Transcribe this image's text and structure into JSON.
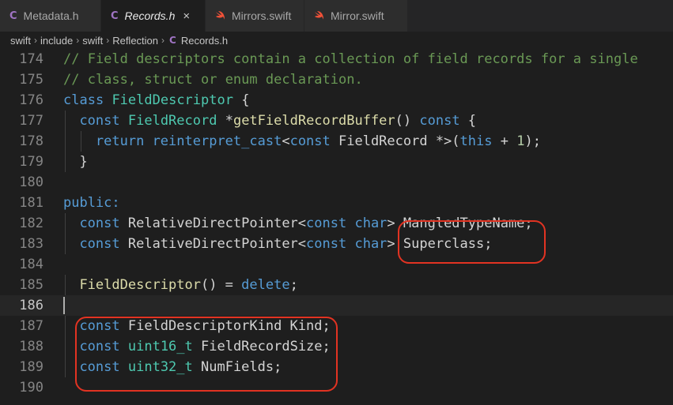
{
  "tabs": [
    {
      "name": "Metadata.h",
      "kind": "c",
      "active": false
    },
    {
      "name": "Records.h",
      "kind": "c",
      "active": true
    },
    {
      "name": "Mirrors.swift",
      "kind": "swift",
      "active": false
    },
    {
      "name": "Mirror.swift",
      "kind": "swift",
      "active": false
    }
  ],
  "tab_icons": {
    "c": "C",
    "close": "×"
  },
  "breadcrumb": [
    "swift",
    "include",
    "swift",
    "Reflection",
    "Records.h"
  ],
  "breadcrumb_sep": "›",
  "colors": {
    "comment": "#6a9955",
    "keyword": "#569cd6",
    "type": "#4ec9b0",
    "function": "#dcdcaa",
    "number": "#b5cea8",
    "text": "#d4d4d4",
    "highlight": "#e23322",
    "c_icon": "#a074c4",
    "swift_icon": "#f05138"
  },
  "current_line": 186,
  "lines": [
    {
      "n": 174,
      "indent": 0,
      "tokens": [
        [
          "cm",
          "// Field descriptors contain a collection of field records for a single"
        ]
      ]
    },
    {
      "n": 175,
      "indent": 0,
      "tokens": [
        [
          "cm",
          "// class, struct or enum declaration."
        ]
      ]
    },
    {
      "n": 176,
      "indent": 0,
      "tokens": [
        [
          "kw",
          "class"
        ],
        [
          "p",
          " "
        ],
        [
          "ty",
          "FieldDescriptor"
        ],
        [
          "p",
          " {"
        ]
      ]
    },
    {
      "n": 177,
      "indent": 1,
      "tokens": [
        [
          "kw",
          "const"
        ],
        [
          "p",
          " "
        ],
        [
          "ty",
          "FieldRecord"
        ],
        [
          "p",
          " *"
        ],
        [
          "fn",
          "getFieldRecordBuffer"
        ],
        [
          "p",
          "() "
        ],
        [
          "kw",
          "const"
        ],
        [
          "p",
          " {"
        ]
      ]
    },
    {
      "n": 178,
      "indent": 2,
      "tokens": [
        [
          "kw",
          "return"
        ],
        [
          "p",
          " "
        ],
        [
          "kw",
          "reinterpret_cast"
        ],
        [
          "p",
          "<"
        ],
        [
          "kw",
          "const"
        ],
        [
          "p",
          " FieldRecord *>("
        ],
        [
          "kw",
          "this"
        ],
        [
          "p",
          " + "
        ],
        [
          "num",
          "1"
        ],
        [
          "p",
          ");"
        ]
      ]
    },
    {
      "n": 179,
      "indent": 1,
      "tokens": [
        [
          "p",
          "}"
        ]
      ]
    },
    {
      "n": 180,
      "indent": 0,
      "tokens": []
    },
    {
      "n": 181,
      "indent": 0,
      "tokens": [
        [
          "kw",
          "public:"
        ]
      ]
    },
    {
      "n": 182,
      "indent": 1,
      "tokens": [
        [
          "kw",
          "const"
        ],
        [
          "p",
          " RelativeDirectPointer<"
        ],
        [
          "kw",
          "const"
        ],
        [
          "p",
          " "
        ],
        [
          "kw",
          "char"
        ],
        [
          "p",
          "> MangledTypeName;"
        ]
      ]
    },
    {
      "n": 183,
      "indent": 1,
      "tokens": [
        [
          "kw",
          "const"
        ],
        [
          "p",
          " RelativeDirectPointer<"
        ],
        [
          "kw",
          "const"
        ],
        [
          "p",
          " "
        ],
        [
          "kw",
          "char"
        ],
        [
          "p",
          "> Superclass;"
        ]
      ]
    },
    {
      "n": 184,
      "indent": 0,
      "tokens": []
    },
    {
      "n": 185,
      "indent": 1,
      "tokens": [
        [
          "fn",
          "FieldDescriptor"
        ],
        [
          "p",
          "() = "
        ],
        [
          "kw",
          "delete"
        ],
        [
          "p",
          ";"
        ]
      ]
    },
    {
      "n": 186,
      "indent": 0,
      "tokens": []
    },
    {
      "n": 187,
      "indent": 1,
      "tokens": [
        [
          "kw",
          "const"
        ],
        [
          "p",
          " FieldDescriptorKind Kind;"
        ]
      ]
    },
    {
      "n": 188,
      "indent": 1,
      "tokens": [
        [
          "kw",
          "const"
        ],
        [
          "p",
          " "
        ],
        [
          "ty",
          "uint16_t"
        ],
        [
          "p",
          " FieldRecordSize;"
        ]
      ]
    },
    {
      "n": 189,
      "indent": 1,
      "tokens": [
        [
          "kw",
          "const"
        ],
        [
          "p",
          " "
        ],
        [
          "ty",
          "uint32_t"
        ],
        [
          "p",
          " NumFields;"
        ]
      ]
    },
    {
      "n": 190,
      "indent": 0,
      "tokens": []
    }
  ]
}
